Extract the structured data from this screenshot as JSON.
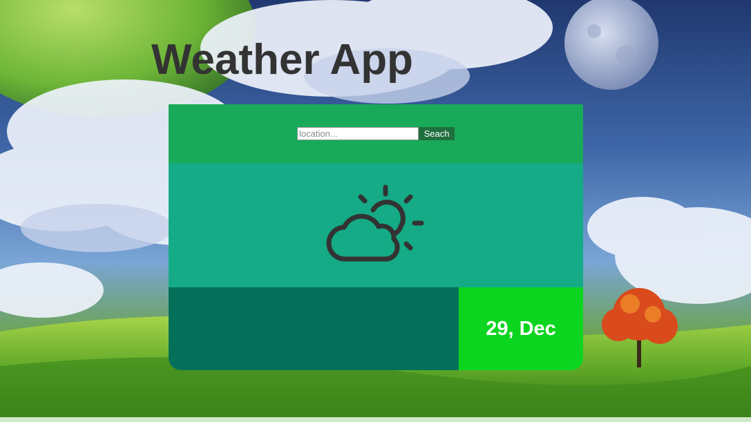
{
  "app": {
    "title": "Weather App"
  },
  "search": {
    "placeholder": "location...",
    "value": "",
    "button_label": "Seach"
  },
  "weather": {
    "icon": "partly-cloudy-icon"
  },
  "date": {
    "label": "29, Dec"
  },
  "colors": {
    "search_bar": "#18aa58",
    "icon_panel": "#14ab86",
    "info_panel": "#05705a",
    "date_panel": "#0cd520",
    "title_text": "#333333",
    "icon_stroke": "#333333"
  }
}
